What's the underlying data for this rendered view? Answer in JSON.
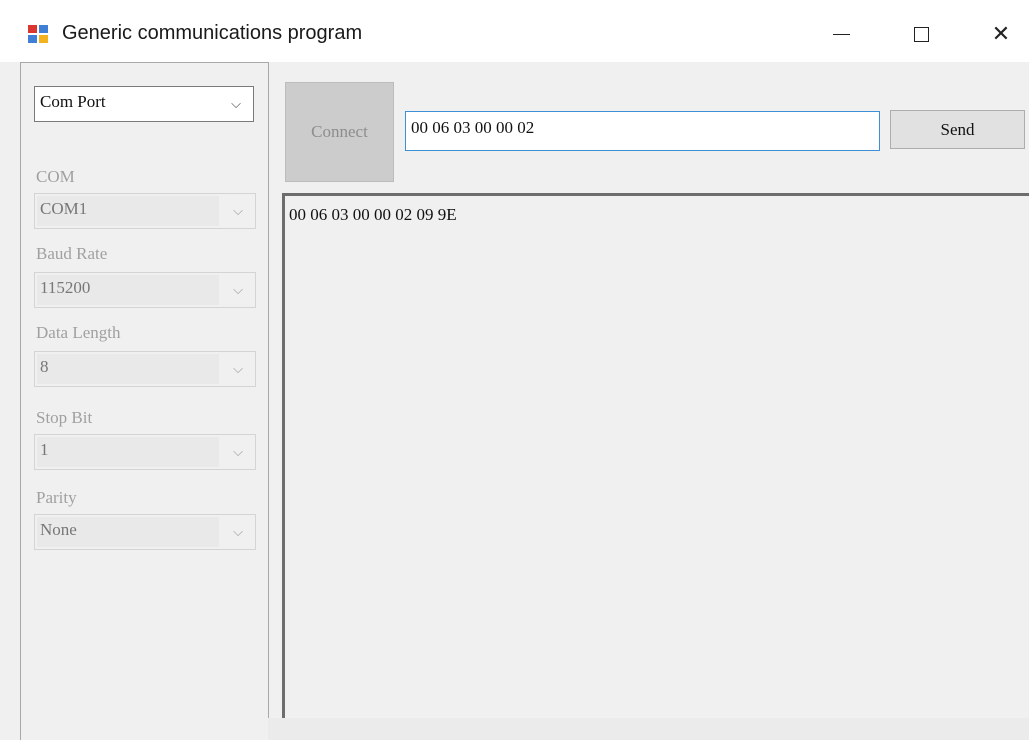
{
  "window": {
    "title": "Generic communications program",
    "icon": "app-window-icon",
    "controls": {
      "minimize_icon": "minimize-icon",
      "maximize_icon": "maximize-icon",
      "close_glyph": "✕"
    }
  },
  "sidebar": {
    "connection_type": {
      "value": "Com Port",
      "arrow": "⌵"
    },
    "com": {
      "label": "COM",
      "value": "COM1"
    },
    "baud_rate": {
      "label": "Baud Rate",
      "value": "115200"
    },
    "data_length": {
      "label": "Data Length",
      "value": "8"
    },
    "stop_bit": {
      "label": "Stop Bit",
      "value": "1"
    },
    "parity": {
      "label": "Parity",
      "value": "None"
    }
  },
  "toolbar": {
    "connect_label": "Connect",
    "send_input_value": "00 06 03 00 00 02",
    "send_label": "Send"
  },
  "output": {
    "text": "00 06 03 00 00 02 09 9E"
  },
  "colors": {
    "window_bg": "#f0f0f0",
    "input_focus_border": "#3d8fd6",
    "disabled_text": "#a0a0a0"
  }
}
